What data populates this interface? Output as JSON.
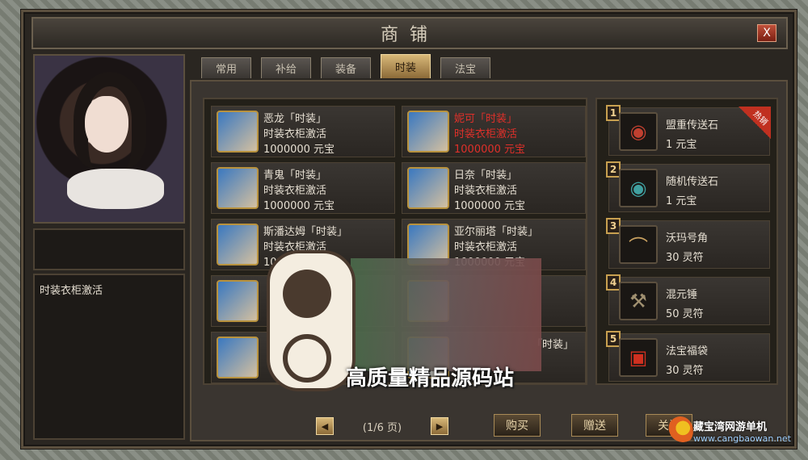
{
  "window": {
    "title": "商铺",
    "close": "X"
  },
  "left": {
    "description": "时装衣柜激活"
  },
  "tabs": [
    {
      "label": "常用"
    },
    {
      "label": "补给"
    },
    {
      "label": "装备"
    },
    {
      "label": "时装",
      "active": true
    },
    {
      "label": "法宝"
    }
  ],
  "items": [
    {
      "name": "恶龙「时装」",
      "desc": "时装衣柜激活",
      "price": "1000000 元宝"
    },
    {
      "name": "妮可「时装」",
      "desc": "时装衣柜激活",
      "price": "1000000 元宝",
      "highlight": true
    },
    {
      "name": "青鬼「时装」",
      "desc": "时装衣柜激活",
      "price": "1000000 元宝"
    },
    {
      "name": "日奈「时装」",
      "desc": "时装衣柜激活",
      "price": "1000000 元宝"
    },
    {
      "name": "斯潘达姆「时装」",
      "desc": "时装衣柜激活",
      "price": "1000000 元宝"
    },
    {
      "name": "亚尔丽塔「时装」",
      "desc": "时装衣柜激活",
      "price": "1000000 元宝"
    },
    {
      "name": "",
      "desc": "",
      "price": ""
    },
    {
      "name": "",
      "desc": "",
      "price": ""
    },
    {
      "name": "",
      "desc": "",
      "price": ""
    },
    {
      "name": "「时装」",
      "desc": "",
      "price": ""
    }
  ],
  "hot": [
    {
      "rank": "1",
      "name": "盟重传送石",
      "price": "1 元宝",
      "icon": "swirl-stone",
      "badge": "热销"
    },
    {
      "rank": "2",
      "name": "随机传送石",
      "price": "1 元宝",
      "icon": "swirl-stone"
    },
    {
      "rank": "3",
      "name": "沃玛号角",
      "price": "30 灵符",
      "icon": "horn"
    },
    {
      "rank": "4",
      "name": "混元锤",
      "price": "50 灵符",
      "icon": "hammer"
    },
    {
      "rank": "5",
      "name": "法宝福袋",
      "price": "30 灵符",
      "icon": "gift-box"
    }
  ],
  "pager": {
    "text": "(1/6 页)",
    "prev": "◀",
    "next": "▶"
  },
  "buttons": {
    "buy": "购买",
    "gift": "赠送",
    "close": "关闭"
  },
  "watermark": {
    "text": "高质量精品源码站",
    "site_name": "藏宝湾网游单机",
    "site_url": "www.cangbaowan.net"
  },
  "colors": {
    "highlight": "#e0302a",
    "gold": "#d8b878"
  }
}
